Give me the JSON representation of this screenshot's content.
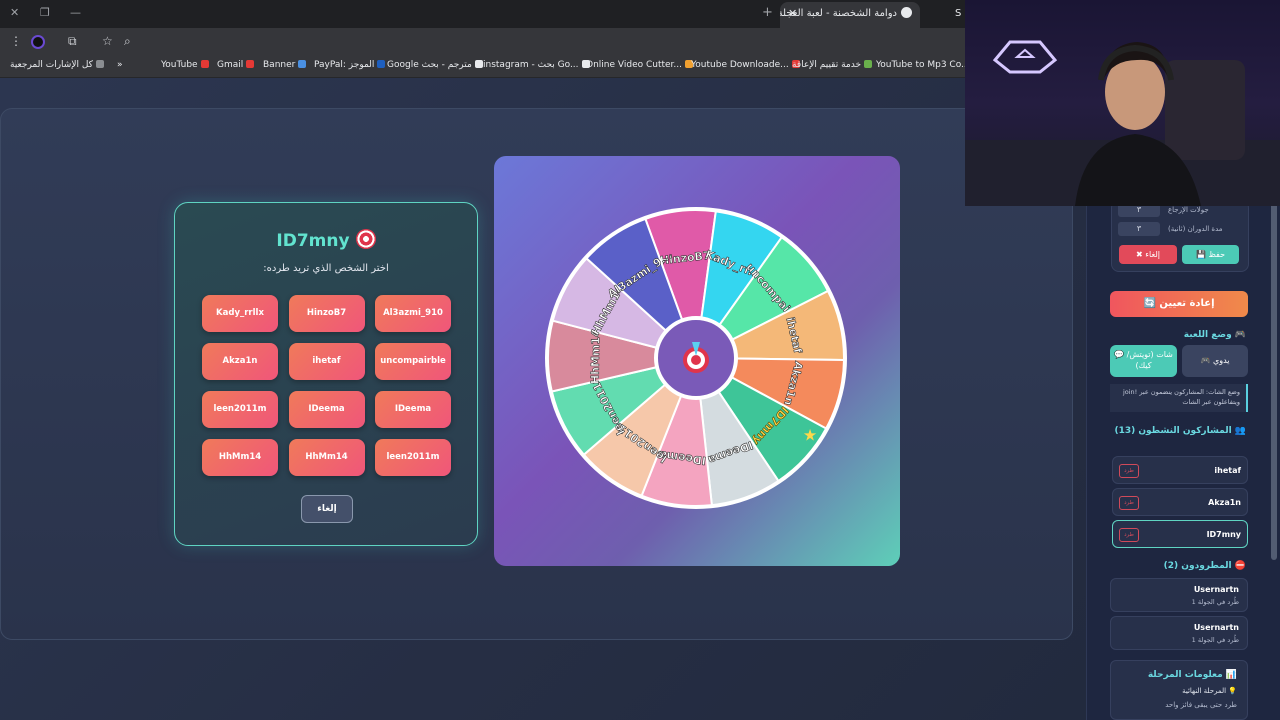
{
  "browser": {
    "active_tab_title": "دوامة الشخصنة - لعبة العجلة وال",
    "next_tab_label": "S",
    "bookmarks": [
      {
        "label": "كل الإشارات المرجعية",
        "color": "#8a8d91"
      },
      {
        "label": "YouTube",
        "color": "#e53935"
      },
      {
        "label": "Gmail",
        "color": "#e53935"
      },
      {
        "label": "Banner",
        "color": "#4a90e2"
      },
      {
        "label": "PayPal: الموجز",
        "color": "#1e5fbf"
      },
      {
        "label": "Google مترجم - بحث",
        "color": "#e8eaed"
      },
      {
        "label": "instagram - بحث Go...",
        "color": "#e8eaed"
      },
      {
        "label": "Online Video Cutter...",
        "color": "#f0a030"
      },
      {
        "label": "Youtube Downloade...",
        "color": "#e53935"
      },
      {
        "label": "خدمة تقييم الإعاقة",
        "color": "#6ab04c"
      },
      {
        "label": "YouTube to Mp3 Co...",
        "color": "#4a90e2"
      }
    ]
  },
  "kick_panel": {
    "title": "ID7mny",
    "subtitle": "اختر الشخص الذي تريد طرده:",
    "players": [
      "Kady_rrllx",
      "HinzoB7",
      "Al3azmi_910",
      "Akza1n",
      "ihetaf",
      "uncompairble",
      "leen2011m",
      "IDeema",
      "IDeema",
      "HhMm14",
      "HhMm14",
      "leen2011m"
    ],
    "cancel_label": "إلغاء"
  },
  "wheel": {
    "center_icon": "target-icon",
    "segments": [
      {
        "name": "HinzoB7",
        "color": "#e05aa8"
      },
      {
        "name": "Kady_rr...",
        "color": "#34d6f0"
      },
      {
        "name": "uncompai...",
        "color": "#56e6a8"
      },
      {
        "name": "ihetaf",
        "color": "#f4b878"
      },
      {
        "name": "Akza1n",
        "color": "#f48a5c"
      },
      {
        "name": "ID7mny",
        "color": "#3ec598"
      },
      {
        "name": "IDeema",
        "color": "#d4dce0"
      },
      {
        "name": "IDeema",
        "color": "#f4a4c0"
      },
      {
        "name": "leen2011m",
        "color": "#f6c8aa"
      },
      {
        "name": "leen2011m",
        "color": "#62dcb0"
      },
      {
        "name": "HhMm14",
        "color": "#d88a9c"
      },
      {
        "name": "HhMm14",
        "color": "#d6b8e4"
      },
      {
        "name": "Al3azmi_9...",
        "color": "#5a60c8"
      }
    ],
    "winner": "ID7mny"
  },
  "sidebar": {
    "rounds_label": "جولات الإرجاع",
    "rounds_value": "٣",
    "spin_label": "مدة الدوران (ثانية)",
    "spin_value": "٣",
    "cancel_label": "✖ إلغاء",
    "save_label": "💾 حفظ",
    "reset_label": "🔄 إعادة تعيين",
    "mode_title": "🎮 وضع اللعبة",
    "mode_normal": "🎮 يدوي",
    "mode_chat": "💬 شات (تويتش/كيك)",
    "mode_desc": "وضع الشات: المشاركون ينضمون عبر !join ويتفاعلون عبر الشات",
    "active_title": "👥 المشاركون النشطون (13)",
    "active_players": [
      "ihetaf",
      "Akza1n",
      "ID7mny"
    ],
    "kick_label": "طرد",
    "eliminated_title": "⛔ المطرودون (2)",
    "eliminated": [
      {
        "name": "Usernartn",
        "round": "طُرد في الجولة 1"
      },
      {
        "name": "Usernartn",
        "round": "طُرد في الجولة 1"
      }
    ],
    "stage_title": "📊 معلومات المرحلة",
    "stage_name": "💡 المرحلة النهائية",
    "stage_desc": "طرد حتى يبقى فائز واحد"
  }
}
